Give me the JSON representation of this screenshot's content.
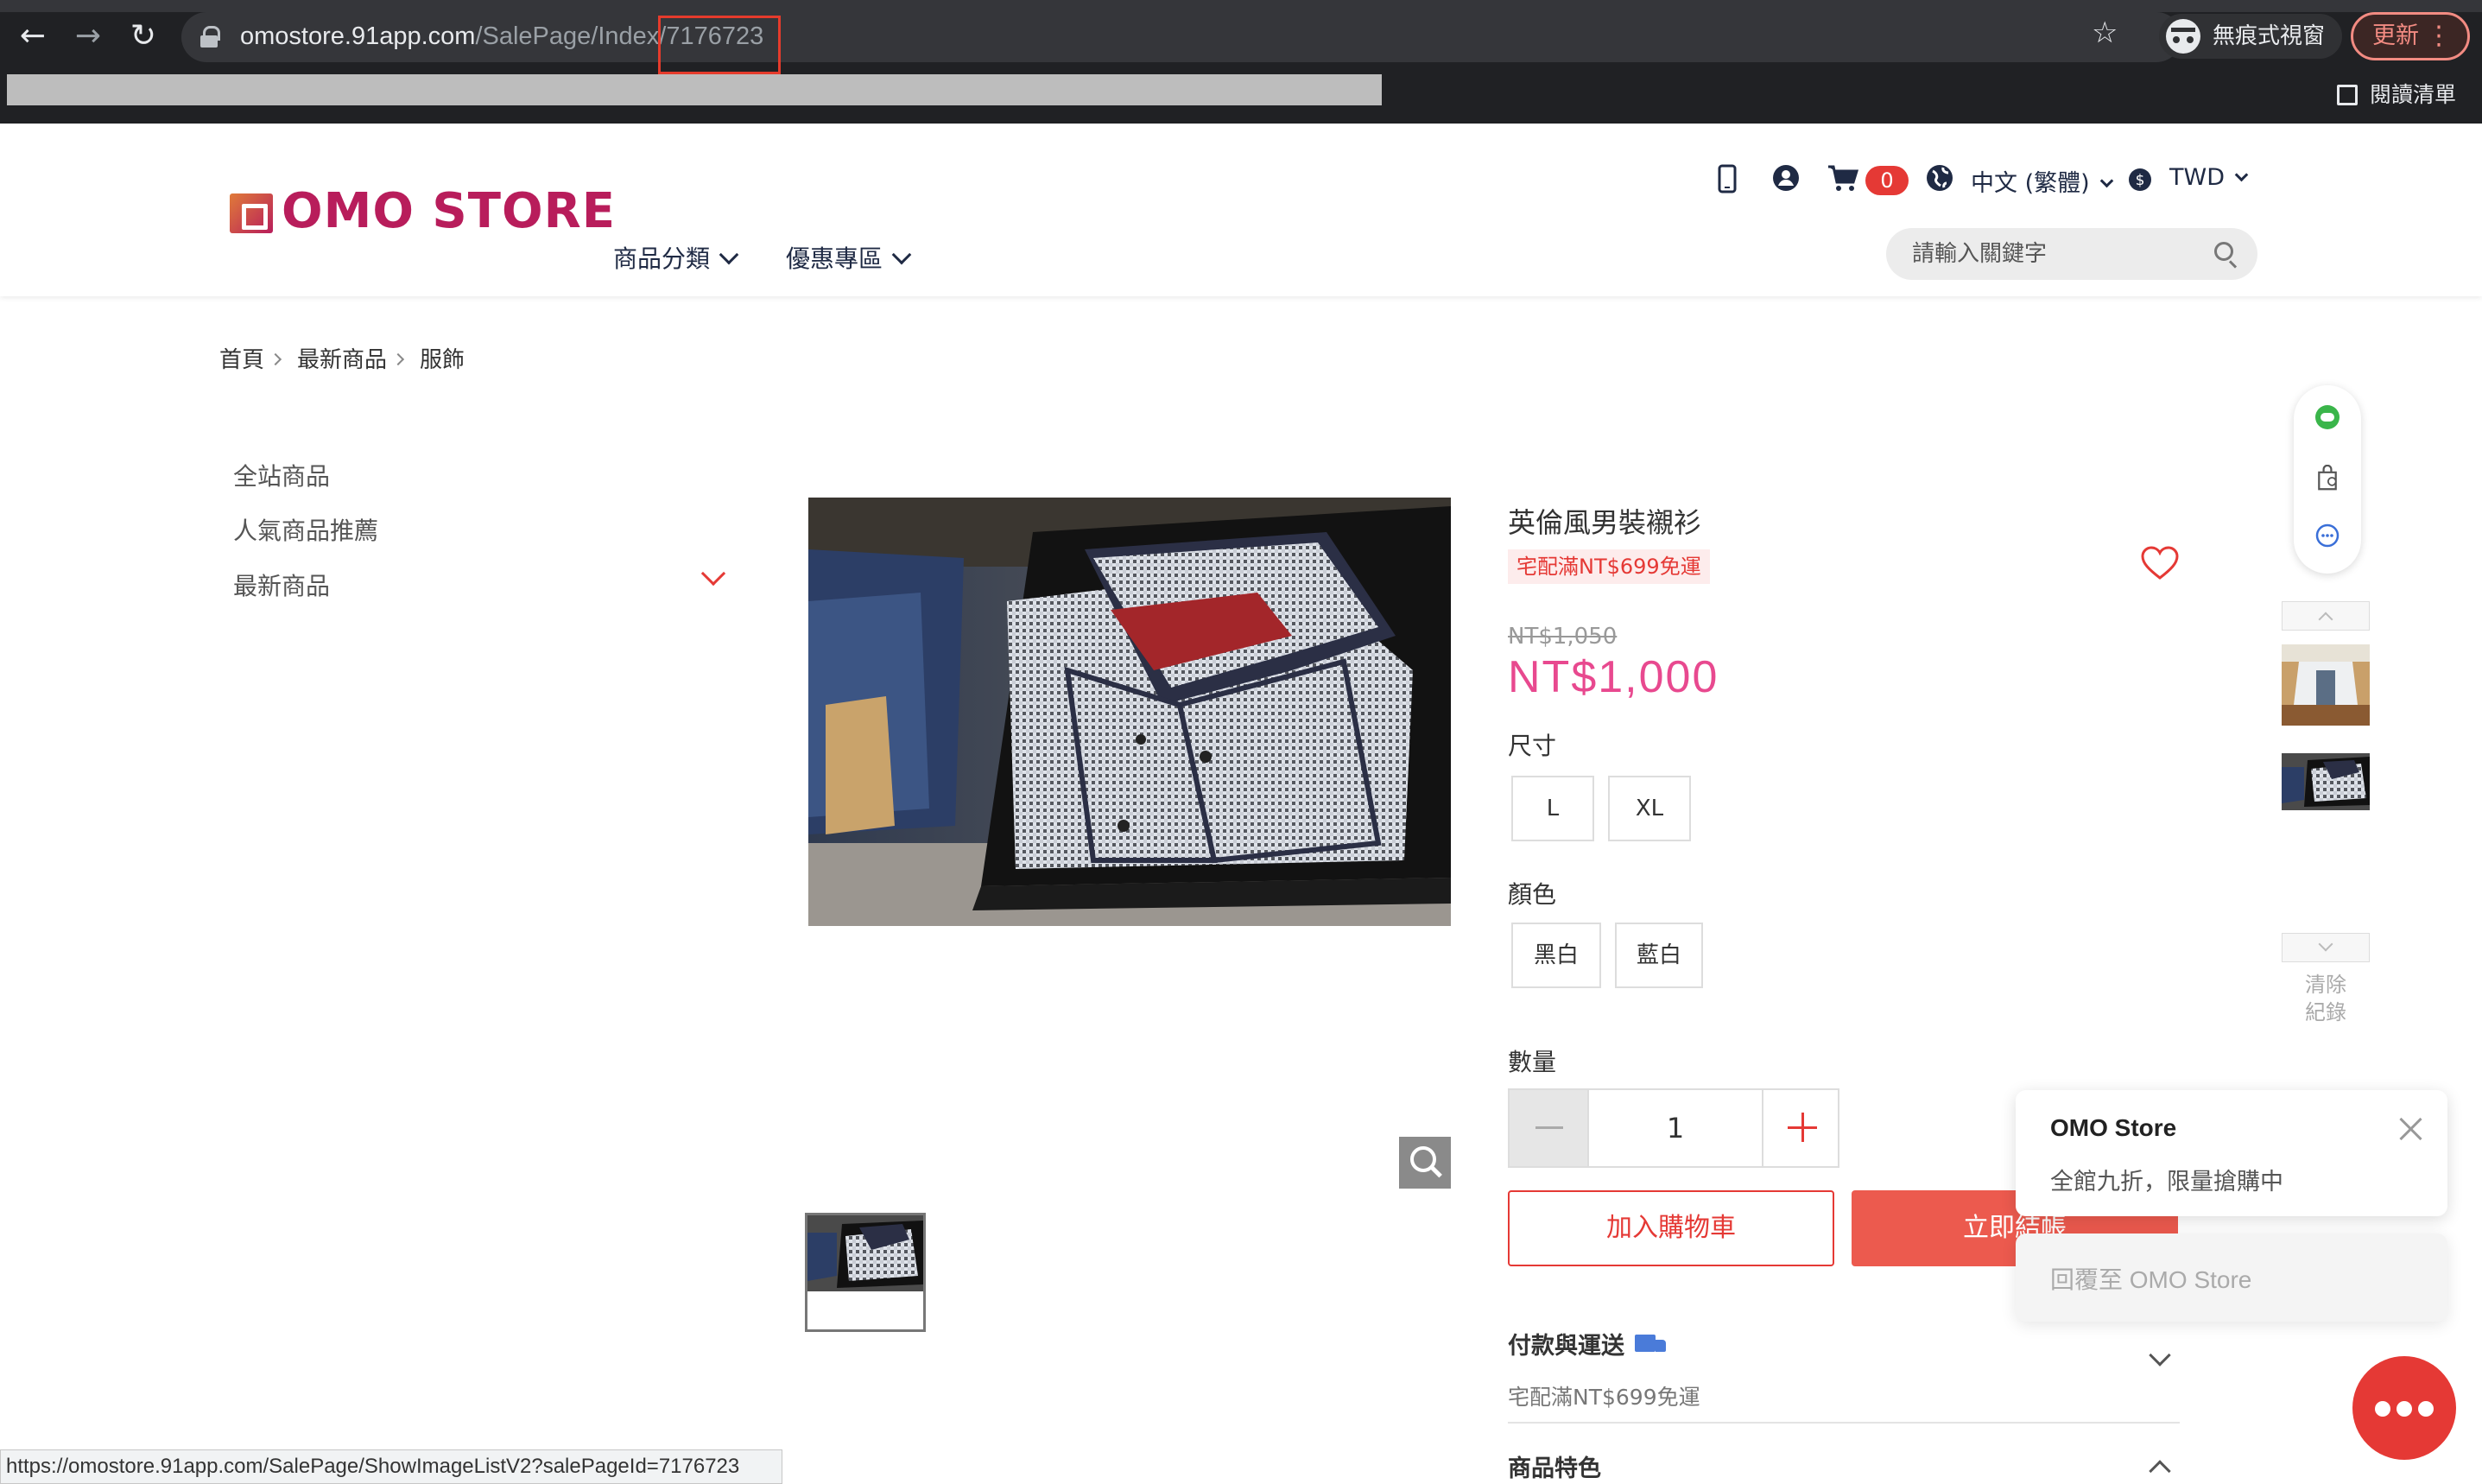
{
  "browser": {
    "url_host": "omostore.91app.com",
    "url_path": "/SalePage/Index/7176723",
    "incognito_label": "無痕式視窗",
    "update_label": "更新",
    "reading_list_label": "閱讀清單",
    "status_url": "https://omostore.91app.com/SalePage/ShowImageListV2?salePageId=7176723"
  },
  "header": {
    "logo_text": "OMO STORE",
    "nav": [
      "商品分類",
      "優惠專區"
    ],
    "cart_count": "0",
    "language": "中文 (繁體)",
    "currency": "TWD",
    "search_placeholder": "請輸入關鍵字"
  },
  "breadcrumb": [
    "首頁",
    "最新商品",
    "服飾"
  ],
  "sidebar": {
    "categories": [
      "全站商品",
      "人氣商品推薦",
      "最新商品"
    ]
  },
  "product": {
    "title": "英倫風男裝襯衫",
    "shipping_tag": "宅配滿NT$699免運",
    "original_price": "NT$1,050",
    "price": "NT$1,000",
    "size_label": "尺寸",
    "sizes": [
      "L",
      "XL"
    ],
    "color_label": "顏色",
    "colors": [
      "黑白",
      "藍白"
    ],
    "quantity_label": "數量",
    "quantity": "1",
    "add_to_cart_label": "加入購物車",
    "buy_now_label": "立即結帳",
    "accordion": {
      "payment_title": "付款與運送",
      "payment_sub": "宅配滿NT$699免運",
      "feature_title": "商品特色"
    }
  },
  "recent": {
    "clear_label": "清除紀錄"
  },
  "chat": {
    "name": "OMO Store",
    "message": "全館九折，限量搶購中",
    "reply_placeholder": "回覆至 OMO Store"
  },
  "colors": {
    "accent": "#e53935",
    "price": "#e8498f",
    "brand": "#b81d5b"
  }
}
